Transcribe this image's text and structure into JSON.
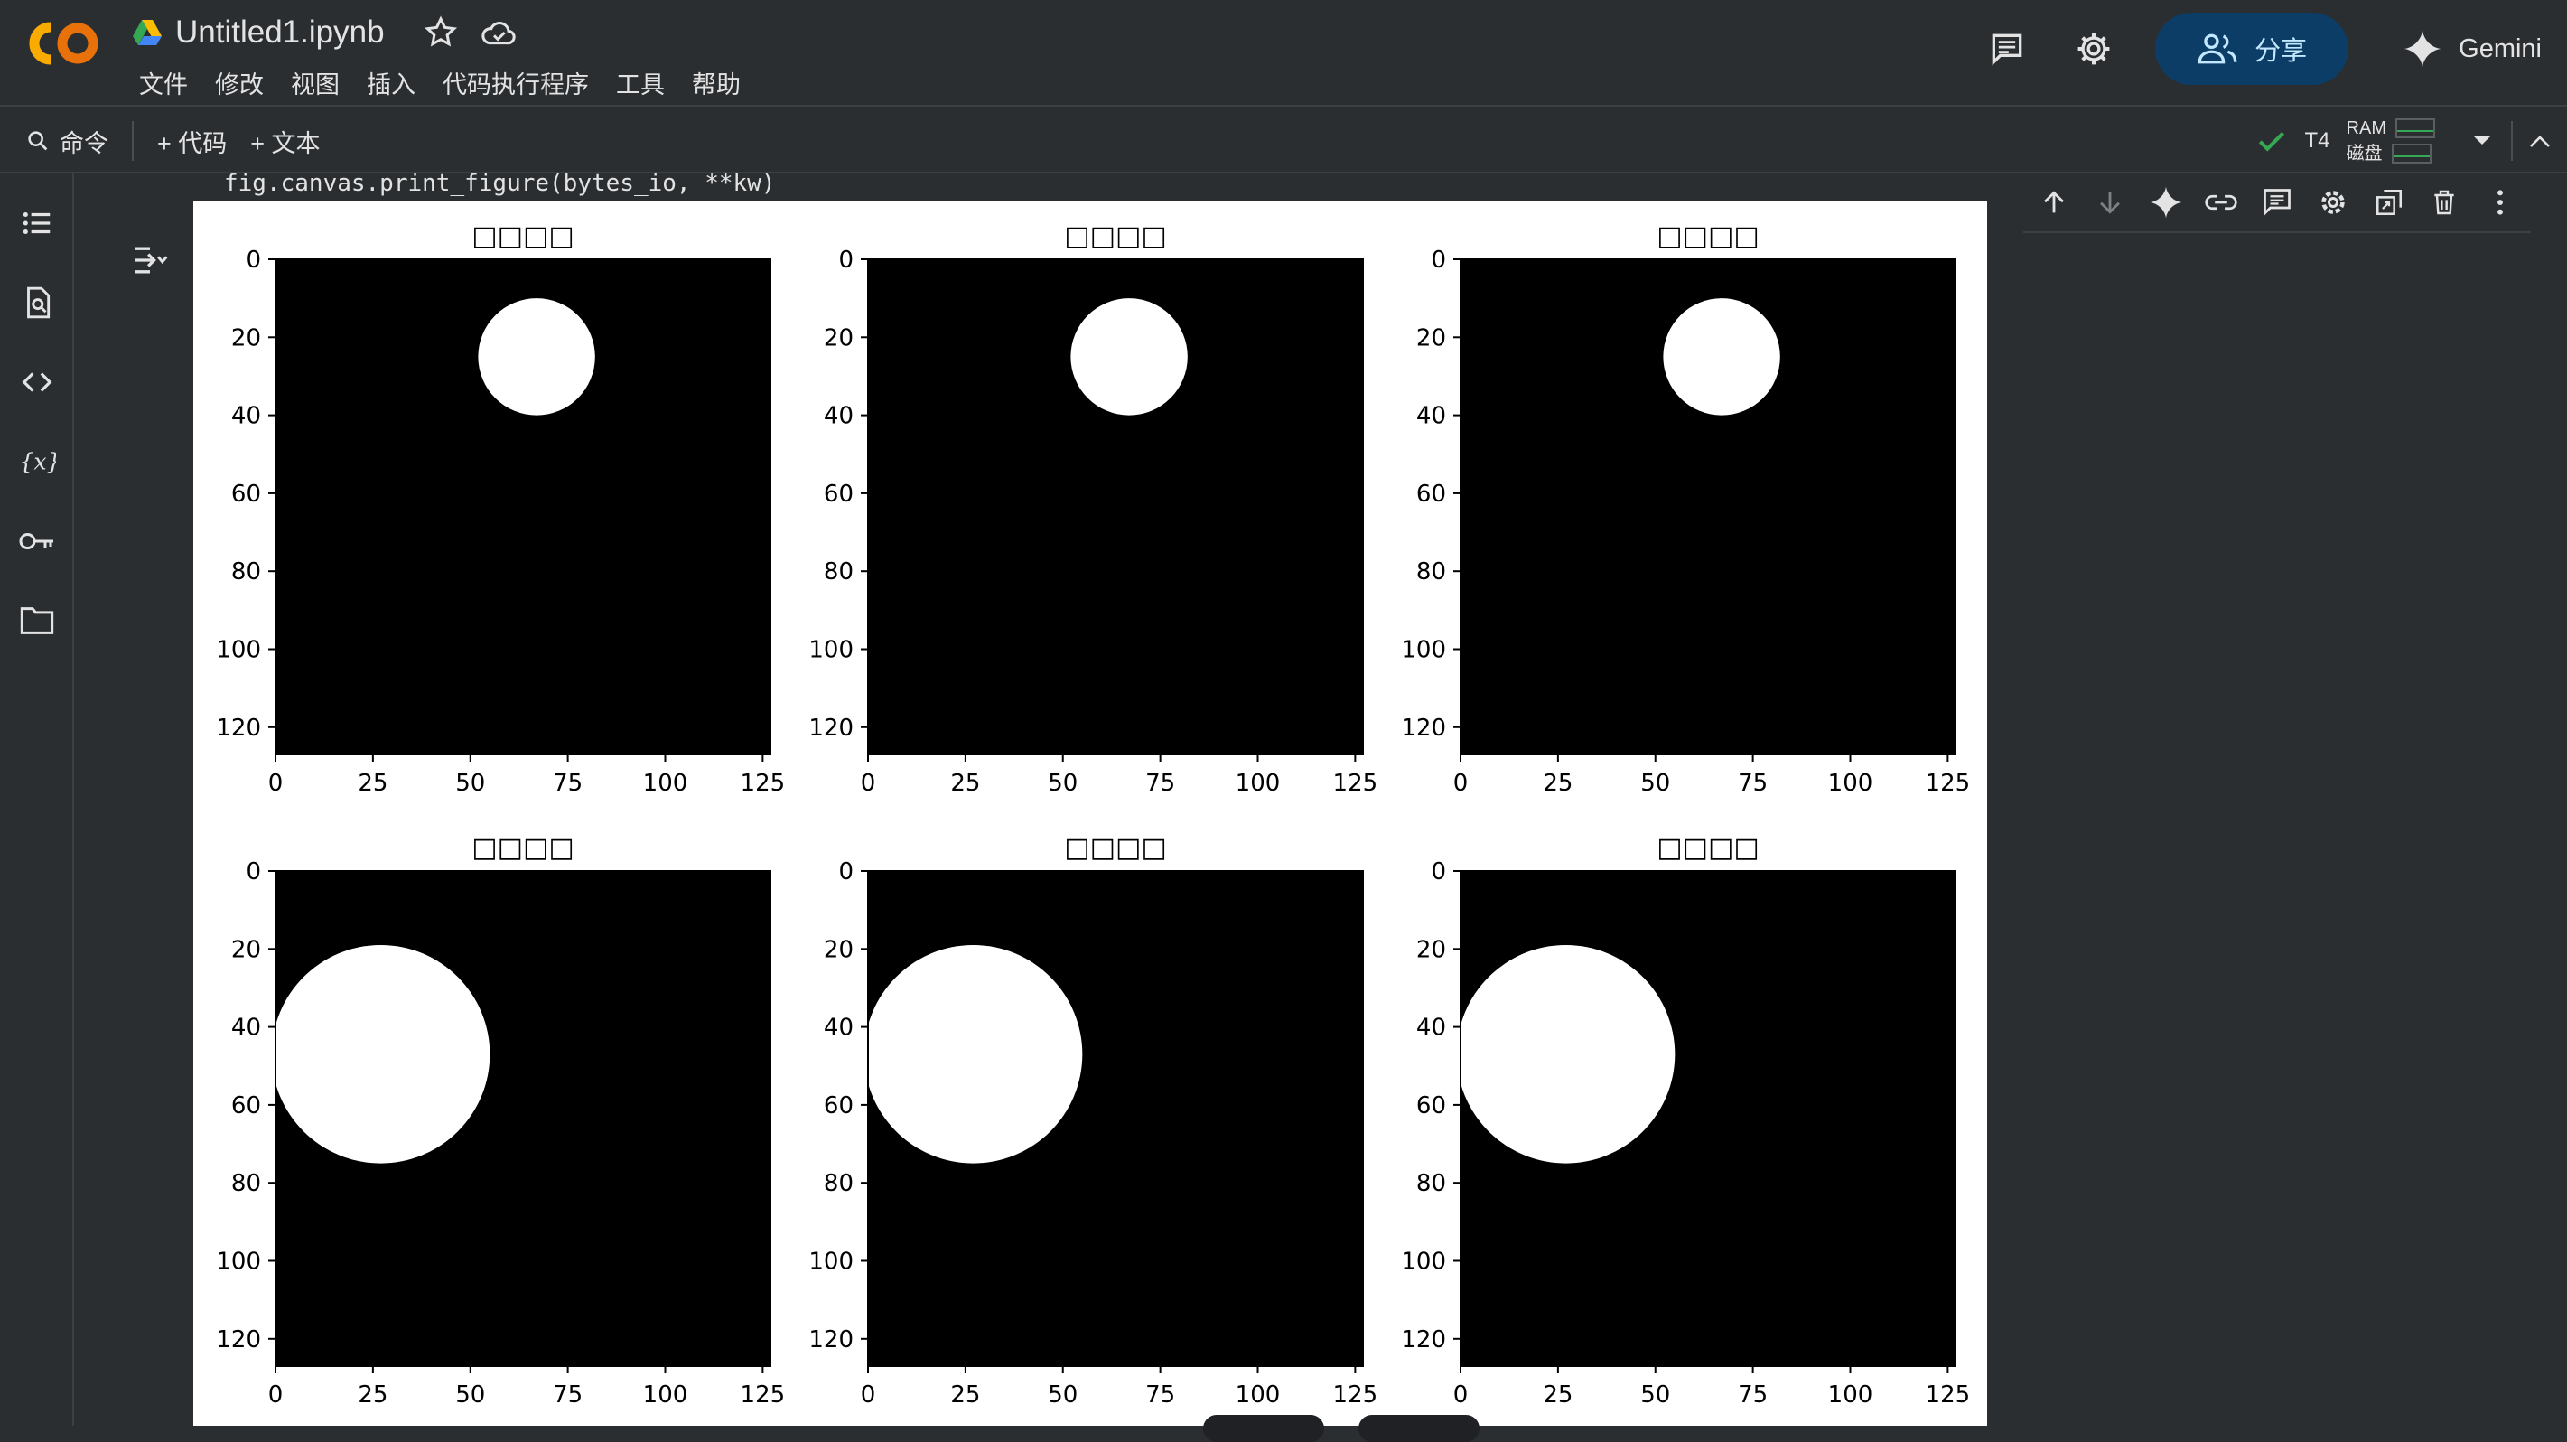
{
  "app": {
    "logo_text": "CO",
    "notebook_title": "Untitled1.ipynb",
    "menu": [
      "文件",
      "修改",
      "视图",
      "插入",
      "代码执行程序",
      "工具",
      "帮助"
    ],
    "share_label": "分享",
    "gemini_label": "Gemini"
  },
  "toolbar": {
    "command_label": "命令",
    "add_code_label": "+ 代码",
    "add_text_label": "+ 文本",
    "runtime_label": "T4",
    "ram_label": "RAM",
    "disk_label": "磁盘"
  },
  "left_rail": [
    "table-of-contents-icon",
    "find-replace-icon",
    "code-snippets-icon",
    "variables-icon",
    "secrets-key-icon",
    "files-folder-icon"
  ],
  "cell": {
    "stderr_text": "fig.canvas.print_figure(bytes_io, **kw)"
  },
  "colors": {
    "background": "#2b2e31",
    "share_bg": "#0b3d66",
    "share_fg": "#c2e7ff",
    "check": "#34a853",
    "plot_fg": "#ffffff",
    "plot_bg": "#000000"
  },
  "chart_data": [
    {
      "type": "heatmap",
      "title": "□□□□",
      "colormap": "gray",
      "xlim": [
        0,
        127
      ],
      "ylim": [
        127,
        0
      ],
      "xticks": [
        0,
        25,
        50,
        75,
        100,
        125
      ],
      "yticks": [
        0,
        20,
        40,
        60,
        80,
        100,
        120
      ],
      "circle": {
        "center_x": 67,
        "center_y": 25,
        "radius": 15
      }
    },
    {
      "type": "heatmap",
      "title": "□□□□",
      "colormap": "gray",
      "xlim": [
        0,
        127
      ],
      "ylim": [
        127,
        0
      ],
      "xticks": [
        0,
        25,
        50,
        75,
        100,
        125
      ],
      "yticks": [
        0,
        20,
        40,
        60,
        80,
        100,
        120
      ],
      "circle": {
        "center_x": 67,
        "center_y": 25,
        "radius": 15
      }
    },
    {
      "type": "heatmap",
      "title": "□□□□",
      "colormap": "gray",
      "xlim": [
        0,
        127
      ],
      "ylim": [
        127,
        0
      ],
      "xticks": [
        0,
        25,
        50,
        75,
        100,
        125
      ],
      "yticks": [
        0,
        20,
        40,
        60,
        80,
        100,
        120
      ],
      "circle": {
        "center_x": 67,
        "center_y": 25,
        "radius": 15
      }
    },
    {
      "type": "heatmap",
      "title": "□□□□",
      "colormap": "gray",
      "xlim": [
        0,
        127
      ],
      "ylim": [
        127,
        0
      ],
      "xticks": [
        0,
        25,
        50,
        75,
        100,
        125
      ],
      "yticks": [
        0,
        20,
        40,
        60,
        80,
        100,
        120
      ],
      "circle": {
        "center_x": 27,
        "center_y": 47,
        "radius": 28
      }
    },
    {
      "type": "heatmap",
      "title": "□□□□",
      "colormap": "gray",
      "xlim": [
        0,
        127
      ],
      "ylim": [
        127,
        0
      ],
      "xticks": [
        0,
        25,
        50,
        75,
        100,
        125
      ],
      "yticks": [
        0,
        20,
        40,
        60,
        80,
        100,
        120
      ],
      "circle": {
        "center_x": 27,
        "center_y": 47,
        "radius": 28
      }
    },
    {
      "type": "heatmap",
      "title": "□□□□",
      "colormap": "gray",
      "xlim": [
        0,
        127
      ],
      "ylim": [
        127,
        0
      ],
      "xticks": [
        0,
        25,
        50,
        75,
        100,
        125
      ],
      "yticks": [
        0,
        20,
        40,
        60,
        80,
        100,
        120
      ],
      "circle": {
        "center_x": 27,
        "center_y": 47,
        "radius": 28
      }
    }
  ]
}
